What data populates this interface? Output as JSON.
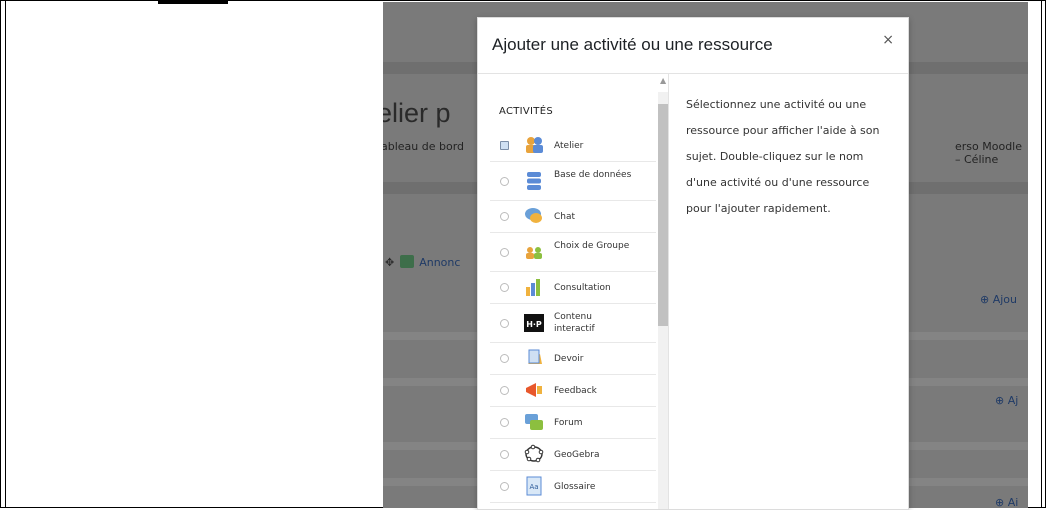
{
  "background": {
    "page_title_fragment": "elier p",
    "crumb_left": "ableau de bord",
    "crumb_right": "erso Moodle – Céline",
    "announce_label": "Annonc",
    "add_label_1": "Ajou",
    "add_label_2": "Aj",
    "add_label_3": "Ai"
  },
  "modal": {
    "title": "Ajouter une activité ou une ressource",
    "close_glyph": "×",
    "section_heading": "ACTIVITÉS",
    "help_text": "Sélectionnez une activité ou une ressource pour afficher l'aide à son sujet. Double-cliquez sur le nom d'une activité ou d'une ressource pour l'ajouter rapidement.",
    "items": [
      {
        "label": "Atelier",
        "icon": "atelier-icon",
        "selected": true
      },
      {
        "label": "Base de données",
        "icon": "database-icon",
        "selected": false
      },
      {
        "label": "Chat",
        "icon": "chat-icon",
        "selected": false
      },
      {
        "label": "Choix de Groupe",
        "icon": "group-choice-icon",
        "selected": false
      },
      {
        "label": "Consultation",
        "icon": "consultation-icon",
        "selected": false
      },
      {
        "label": "Contenu interactif",
        "icon": "h5p-icon",
        "selected": false
      },
      {
        "label": "Devoir",
        "icon": "assignment-icon",
        "selected": false
      },
      {
        "label": "Feedback",
        "icon": "feedback-icon",
        "selected": false
      },
      {
        "label": "Forum",
        "icon": "forum-icon",
        "selected": false
      },
      {
        "label": "GeoGebra",
        "icon": "geogebra-icon",
        "selected": false
      },
      {
        "label": "Glossaire",
        "icon": "glossary-icon",
        "selected": false
      }
    ]
  },
  "colors": {
    "overlay_background": "#7a7a7a",
    "link_color": "#1f3a66"
  }
}
